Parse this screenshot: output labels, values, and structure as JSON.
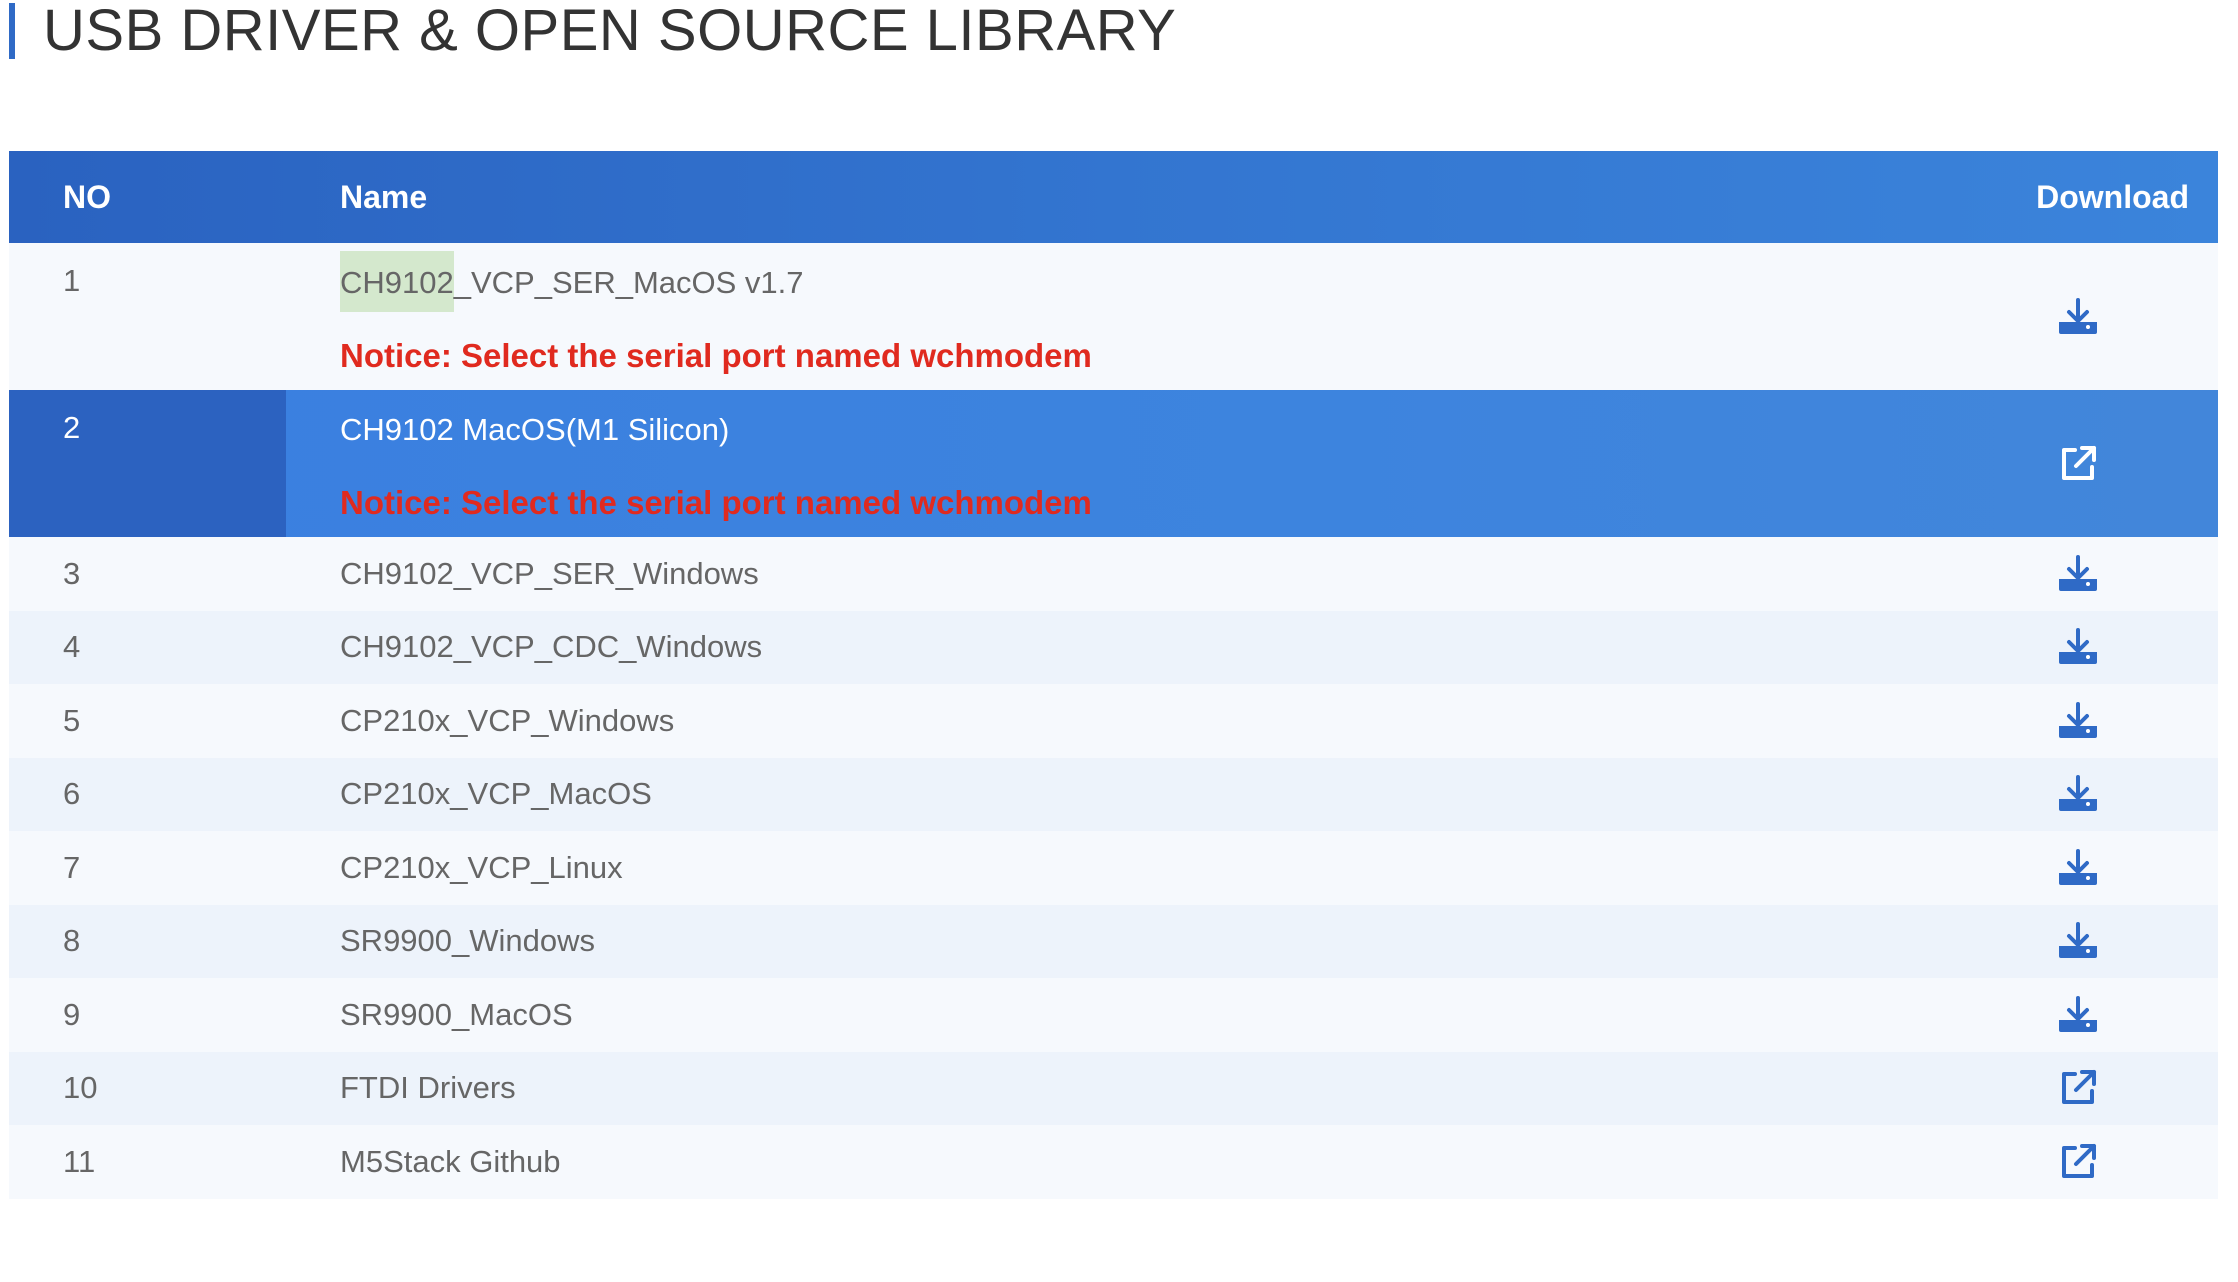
{
  "page_title": "USB DRIVER & OPEN SOURCE LIBRARY",
  "table": {
    "headers": {
      "no": "NO",
      "name": "Name",
      "download": "Download"
    },
    "rows": [
      {
        "no": "1",
        "name_highlight": "CH9102",
        "name_rest": "_VCP_SER_MacOS v1.7",
        "notice": "Notice: Select the serial port named wchmodem",
        "action": "download-icon"
      },
      {
        "no": "2",
        "name": "CH9102 MacOS(M1 Silicon)",
        "notice": "Notice: Select the serial port named wchmodem",
        "action": "external-link-icon"
      },
      {
        "no": "3",
        "name": "CH9102_VCP_SER_Windows",
        "action": "download-icon"
      },
      {
        "no": "4",
        "name": "CH9102_VCP_CDC_Windows",
        "action": "download-icon"
      },
      {
        "no": "5",
        "name": "CP210x_VCP_Windows",
        "action": "download-icon"
      },
      {
        "no": "6",
        "name": "CP210x_VCP_MacOS",
        "action": "download-icon"
      },
      {
        "no": "7",
        "name": "CP210x_VCP_Linux",
        "action": "download-icon"
      },
      {
        "no": "8",
        "name": "SR9900_Windows",
        "action": "download-icon"
      },
      {
        "no": "9",
        "name": "SR9900_MacOS",
        "action": "download-icon"
      },
      {
        "no": "10",
        "name": "FTDI Drivers",
        "action": "external-link-icon"
      },
      {
        "no": "11",
        "name": "M5Stack Github",
        "action": "external-link-icon"
      }
    ]
  },
  "colors": {
    "header_gradient_start": "#2a62c0",
    "header_gradient_end": "#3b84db",
    "selected_row": "#3a7fe0",
    "notice_red": "#e02a1f",
    "icon_blue": "#2f6ac6",
    "highlight_green": "#d4e8cd"
  }
}
